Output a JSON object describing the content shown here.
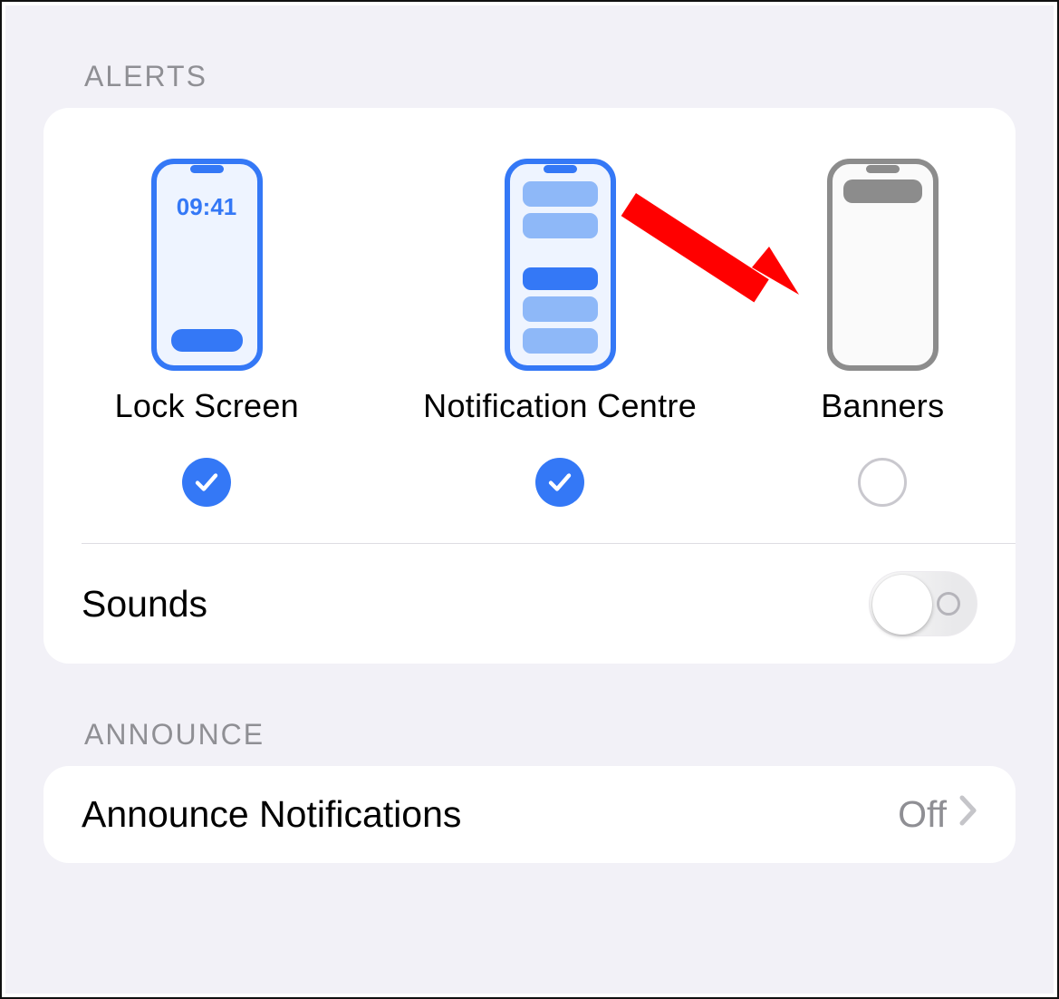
{
  "sections": {
    "alerts": {
      "header": "ALERTS",
      "options": {
        "lock_screen": {
          "label": "Lock Screen",
          "checked": true,
          "time": "09:41"
        },
        "notification_centre": {
          "label": "Notification Centre",
          "checked": true
        },
        "banners": {
          "label": "Banners",
          "checked": false
        }
      },
      "sounds": {
        "label": "Sounds",
        "on": false
      }
    },
    "announce": {
      "header": "ANNOUNCE",
      "announce_notifications": {
        "label": "Announce Notifications",
        "value": "Off"
      }
    }
  },
  "colors": {
    "accent": "#3478f6",
    "accent_light": "#8eb8f8",
    "accent_bg": "#eef4ff",
    "inactive_stroke": "#8c8c8c",
    "inactive_fill": "#fafafa"
  }
}
